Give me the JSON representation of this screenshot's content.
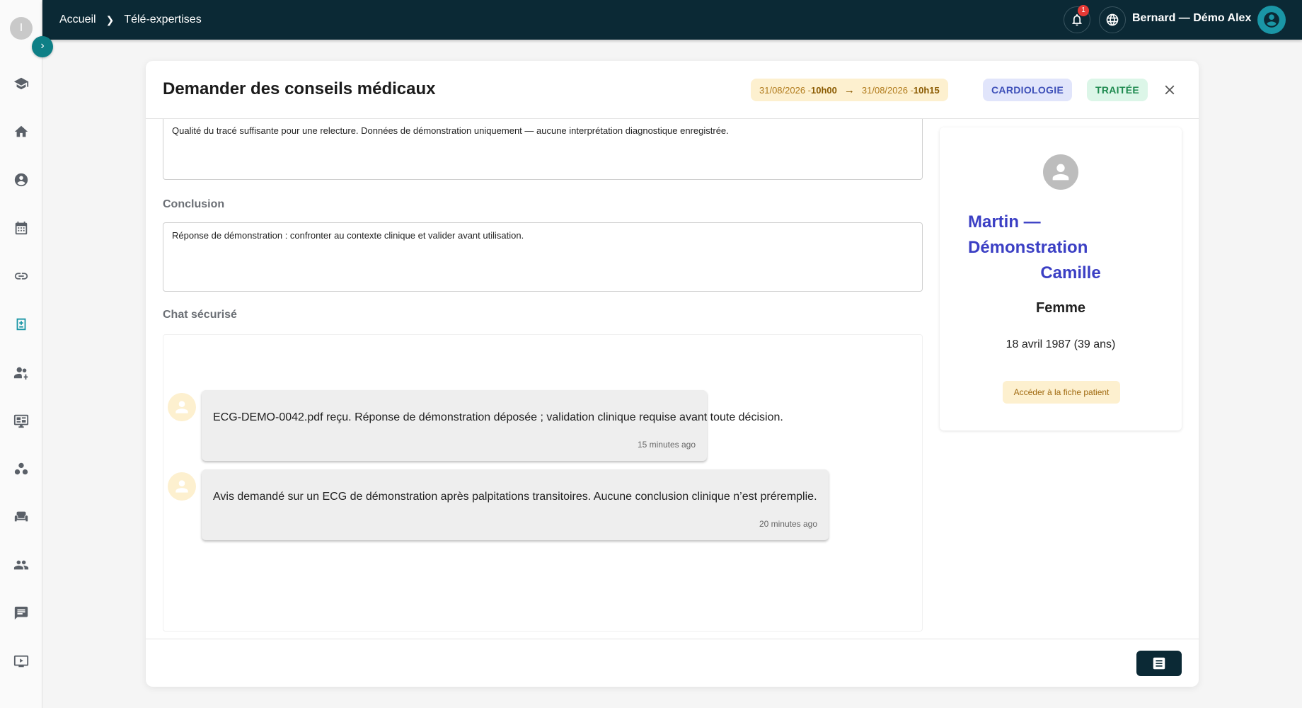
{
  "sidebar": {
    "avatar_letter": "I",
    "toggle_glyph": "›",
    "items": [
      {
        "icon": "graduation-cap-icon"
      },
      {
        "icon": "home-icon"
      },
      {
        "icon": "doctor-badge-icon"
      },
      {
        "icon": "calendar-icon"
      },
      {
        "icon": "link-icon"
      },
      {
        "icon": "medical-consultation-icon",
        "active": true
      },
      {
        "icon": "group-add-icon"
      },
      {
        "icon": "monitor-dashboard-icon"
      },
      {
        "icon": "workspaces-icon"
      },
      {
        "icon": "waiting-room-icon"
      },
      {
        "icon": "people-icon"
      },
      {
        "icon": "chat-icon"
      },
      {
        "icon": "video-icon"
      }
    ]
  },
  "topbar": {
    "breadcrumb": [
      "Accueil",
      "Télé-expertises"
    ],
    "notification_count": "1",
    "user_name": "Bernard — Démo Alex"
  },
  "modal": {
    "title": "Demander des conseils médicaux",
    "date_start": "31/08/2026 - ",
    "time_start": "10h00",
    "date_end": "31/08/2026 - ",
    "time_end": "10h15",
    "specialty": "CARDIOLOGIE",
    "status": "TRAITÉE",
    "colors": {
      "accent": "#0b2935",
      "specialty": "#3d4fb8",
      "status": "#1e8a4f",
      "date": "#b07a1a"
    }
  },
  "form": {
    "observation_text": "Qualité du tracé suffisante pour une relecture. Données de démonstration uniquement — aucune interprétation diagnostique enregistrée.",
    "conclusion_label": "Conclusion",
    "conclusion_text": "Réponse de démonstration : confronter au contexte clinique et valider avant utilisation.",
    "chat_label": "Chat sécurisé"
  },
  "chat": {
    "messages": [
      {
        "text": "ECG-DEMO-0042.pdf reçu. Réponse de démonstration déposée ; validation clinique requise avant toute décision.",
        "time": "15 minutes ago"
      },
      {
        "text": "Avis demandé sur un ECG de démonstration après palpitations transitoires. Aucune conclusion clinique n’est préremplie.",
        "time": "20 minutes ago"
      }
    ]
  },
  "patient": {
    "name_line1": "Martin —",
    "name_line2": "Démonstration",
    "name_line3": "Camille",
    "sex": "Femme",
    "dob": "18 avril 1987 (39 ans)",
    "link_label": "Accéder à la fiche patient"
  }
}
